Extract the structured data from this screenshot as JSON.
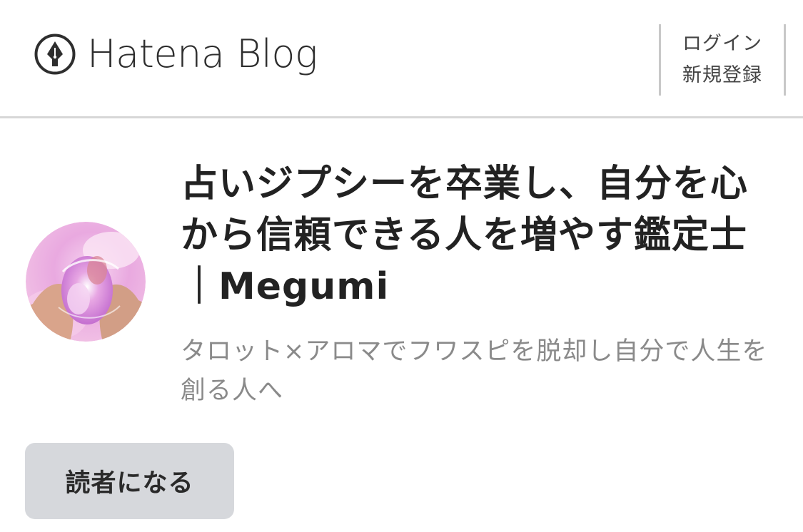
{
  "header": {
    "logo_text": "Hatena Blog",
    "login_label": "ログイン",
    "signup_label": "新規登録"
  },
  "blog": {
    "title": "占いジプシーを卒業し、自分を心から信頼できる人を増やす鑑定士｜Megumi",
    "description": "タロット×アロマでフワスピを脱却し自分で人生を創る人へ"
  },
  "actions": {
    "subscribe_label": "読者になる"
  },
  "colors": {
    "subscribe_bg": "#d6d8dc",
    "divider": "#d7d7d7",
    "description_text": "#8a8a8a"
  }
}
